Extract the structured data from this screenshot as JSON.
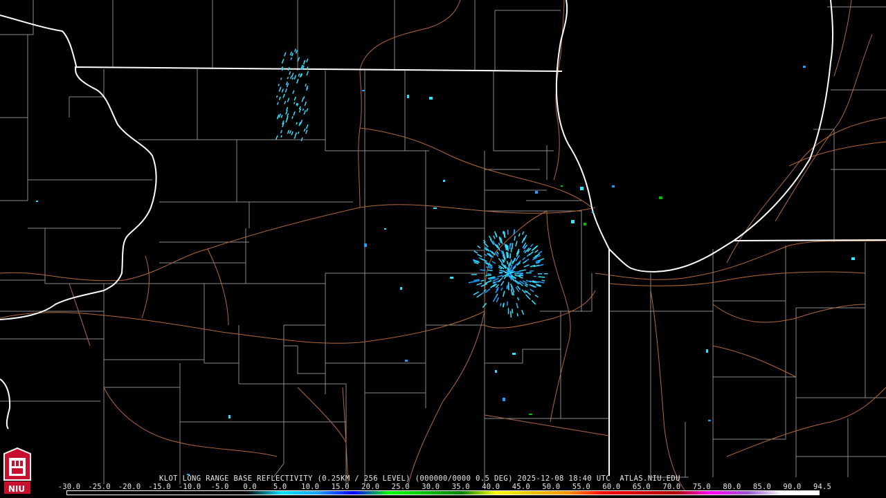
{
  "caption": "KLOT LONG RANGE BASE REFLECTIVITY (0.25KM / 256 LEVEL) (000000/0000 0.5 DEG) 2025-12-08 18:40 UTC  ATLAS.NIU.EDU",
  "logo": {
    "text": "NIU",
    "color": "#c8102e",
    "icon": "university-tower-logo"
  },
  "colorbar": {
    "ticks": [
      "-30.0",
      "-25.0",
      "-20.0",
      "-15.0",
      "-10.0",
      "-5.0",
      "0.0",
      "5.0",
      "10.0",
      "15.0",
      "20.0",
      "25.0",
      "30.0",
      "35.0",
      "40.0",
      "45.0",
      "50.0",
      "55.0",
      "60.0",
      "65.0",
      "70.0",
      "75.0",
      "80.0",
      "85.0",
      "90.0",
      "94.5"
    ],
    "unit_semantics": "reflectivity dBZ scale",
    "colors": [
      "#000000",
      "#000000",
      "#000000",
      "#000000",
      "#000000",
      "#000000",
      "#00e5ff",
      "#1ea0ff",
      "#0000ff",
      "#00ff00",
      "#00c000",
      "#008000",
      "#ffff00",
      "#e6c000",
      "#ff9000",
      "#ff0000",
      "#d00000",
      "#b00000",
      "#ff00ff",
      "#9955cc",
      "#ffffff",
      "#ffffff"
    ]
  },
  "map": {
    "state_border_color": "#ffffff",
    "county_border_color": "#8a8a8a",
    "highway_color": "#b36a3a",
    "echo_colors": [
      "#39d6ff",
      "#1ea0ff",
      "#2ee6ff",
      "#00c000",
      "#0044ff"
    ]
  }
}
